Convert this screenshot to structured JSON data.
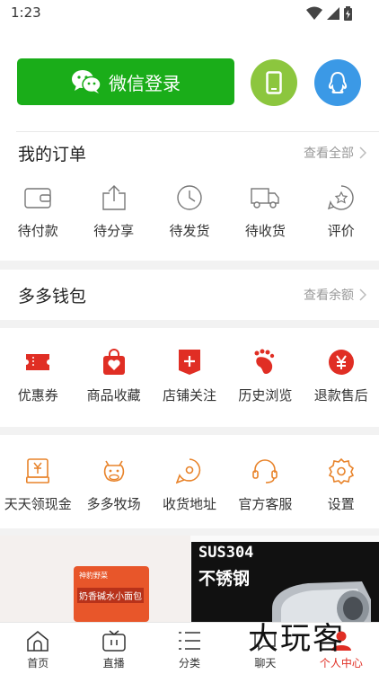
{
  "status": {
    "time": "1:23"
  },
  "login": {
    "wechat_label": "微信登录"
  },
  "orders": {
    "title": "我的订单",
    "more": "查看全部",
    "items": [
      {
        "label": "待付款",
        "icon": "wallet-icon"
      },
      {
        "label": "待分享",
        "icon": "share-icon"
      },
      {
        "label": "待发货",
        "icon": "clock-icon"
      },
      {
        "label": "待收货",
        "icon": "truck-icon"
      },
      {
        "label": "评价",
        "icon": "review-icon"
      }
    ]
  },
  "wallet": {
    "title": "多多钱包",
    "more": "查看余额"
  },
  "favorites": {
    "items": [
      {
        "label": "优惠券",
        "icon": "coupon-icon"
      },
      {
        "label": "商品收藏",
        "icon": "bag-heart-icon"
      },
      {
        "label": "店铺关注",
        "icon": "store-plus-icon"
      },
      {
        "label": "历史浏览",
        "icon": "footprint-icon"
      },
      {
        "label": "退款售后",
        "icon": "yen-circle-icon"
      }
    ]
  },
  "services": {
    "items": [
      {
        "label": "天天领现金",
        "icon": "cash-icon"
      },
      {
        "label": "多多牧场",
        "icon": "cow-icon"
      },
      {
        "label": "收货地址",
        "icon": "location-icon"
      },
      {
        "label": "官方客服",
        "icon": "headset-icon"
      },
      {
        "label": "设置",
        "icon": "gear-icon"
      }
    ]
  },
  "banner": {
    "left_brand": "神豹野菜",
    "left_product": "奶香碱水小面包",
    "right_model": "SUS304",
    "right_title": "不锈钢"
  },
  "tabs": [
    {
      "label": "首页",
      "icon": "home-icon",
      "active": false
    },
    {
      "label": "直播",
      "icon": "tv-icon",
      "active": false
    },
    {
      "label": "分类",
      "icon": "list-icon",
      "active": false
    },
    {
      "label": "聊天",
      "icon": "chat-icon",
      "active": false
    },
    {
      "label": "个人中心",
      "icon": "person-icon",
      "active": true
    }
  ],
  "watermark": "大玩客",
  "colors": {
    "wechat": "#1aad19",
    "phone": "#8cc63e",
    "qq": "#3b99e6",
    "accent_red": "#e02e24",
    "accent_orange": "#e8832a"
  }
}
